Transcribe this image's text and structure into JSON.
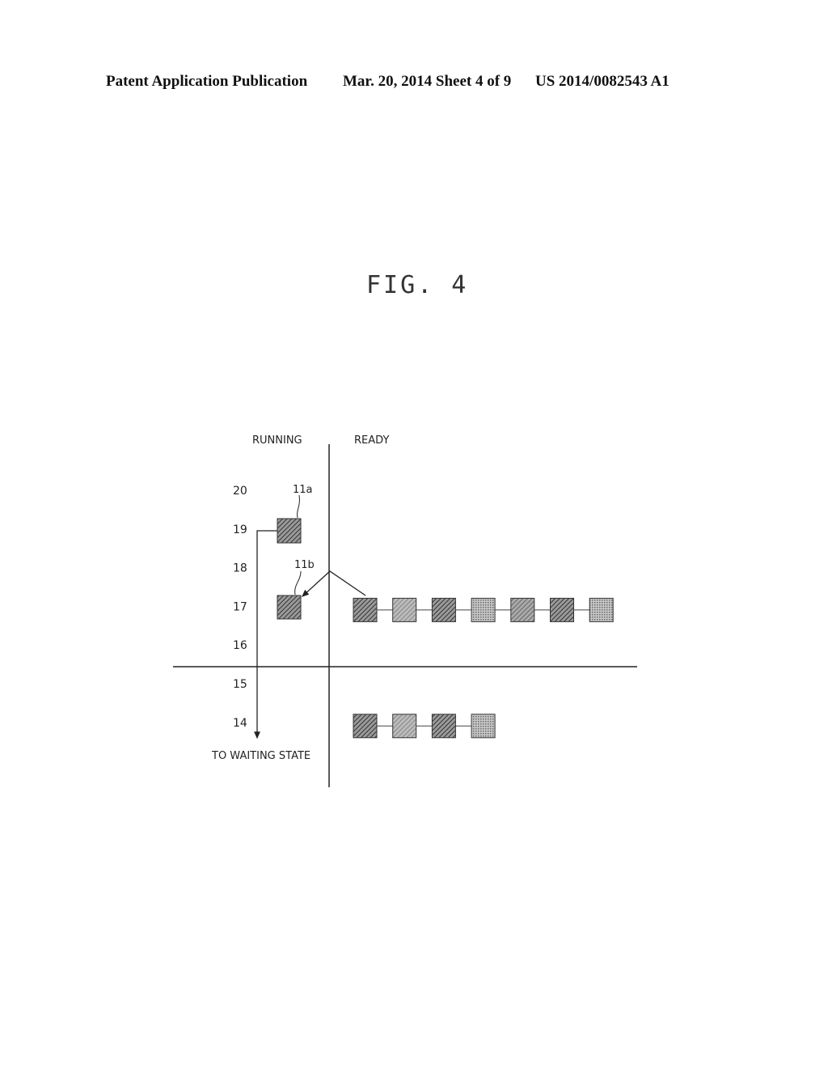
{
  "header": {
    "left": "Patent Application Publication",
    "middle": "Mar. 20, 2014  Sheet 4 of 9",
    "right": "US 2014/0082543 A1"
  },
  "figure": {
    "title": "FIG. 4",
    "columns": {
      "running": "RUNNING",
      "ready": "READY"
    },
    "priority_levels": [
      "20",
      "19",
      "18",
      "17",
      "16",
      "15",
      "14"
    ],
    "running_tasks": [
      {
        "ref": "11a",
        "priority": 19
      },
      {
        "ref": "11b",
        "priority": 17
      }
    ],
    "ready_queues": [
      {
        "priority": 17,
        "task_count": 7,
        "patterns": [
          "dark",
          "light",
          "dark",
          "dots",
          "medium",
          "dark",
          "dots"
        ]
      },
      {
        "priority": 14,
        "task_count": 4,
        "patterns": [
          "dark",
          "light",
          "dark",
          "dots"
        ]
      }
    ],
    "waiting_label": "TO WAITING STATE"
  }
}
